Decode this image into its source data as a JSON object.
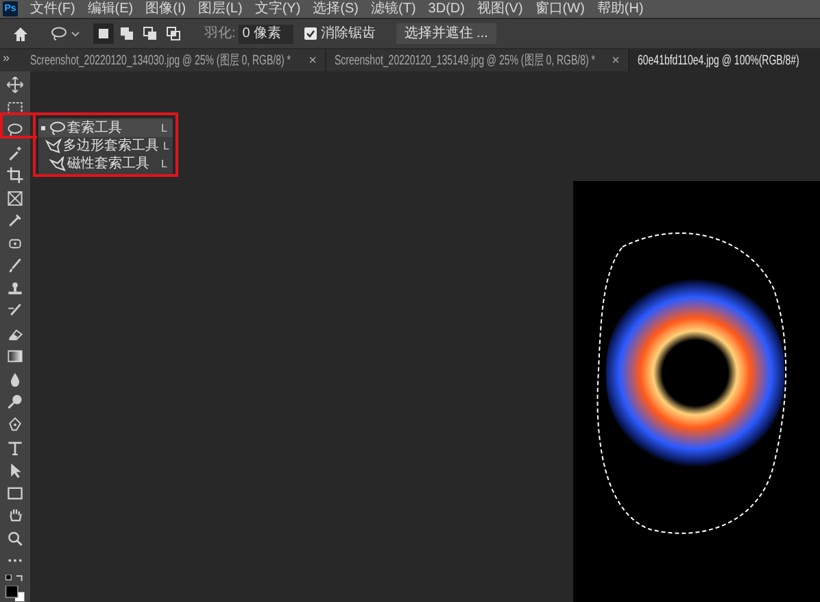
{
  "app_logo": "Ps",
  "menu": [
    "文件(F)",
    "编辑(E)",
    "图像(I)",
    "图层(L)",
    "文字(Y)",
    "选择(S)",
    "滤镜(T)",
    "3D(D)",
    "视图(V)",
    "窗口(W)",
    "帮助(H)"
  ],
  "options_bar": {
    "selection_modes": [
      {
        "selected": true
      },
      {
        "selected": false
      },
      {
        "selected": false
      },
      {
        "selected": false
      }
    ],
    "feather_label": "羽化:",
    "feather_value": "0 像素",
    "anti_alias": {
      "label": "消除锯齿",
      "checked": true
    },
    "select_mask_button": "选择并遮住 ..."
  },
  "panel_toggle": "»",
  "tabs": [
    {
      "label": "Screenshot_20220120_134030.jpg @ 25% (图层 0, RGB/8) *",
      "close": "×",
      "selected": false
    },
    {
      "label": "Screenshot_20220120_135149.jpg @ 25% (图层 0, RGB/8) *",
      "close": "×",
      "selected": false
    },
    {
      "label": "60e41bfd110e4.jpg @ 100%(RGB/8#)",
      "selected": true
    }
  ],
  "tool_flyout": [
    {
      "kind": "lasso",
      "label": "套索工具",
      "shortcut": "L",
      "selected": true
    },
    {
      "kind": "polygon",
      "label": "多边形套索工具",
      "shortcut": "L",
      "selected": false
    },
    {
      "kind": "magnetic",
      "label": "磁性套索工具",
      "shortcut": "L",
      "selected": false
    }
  ]
}
